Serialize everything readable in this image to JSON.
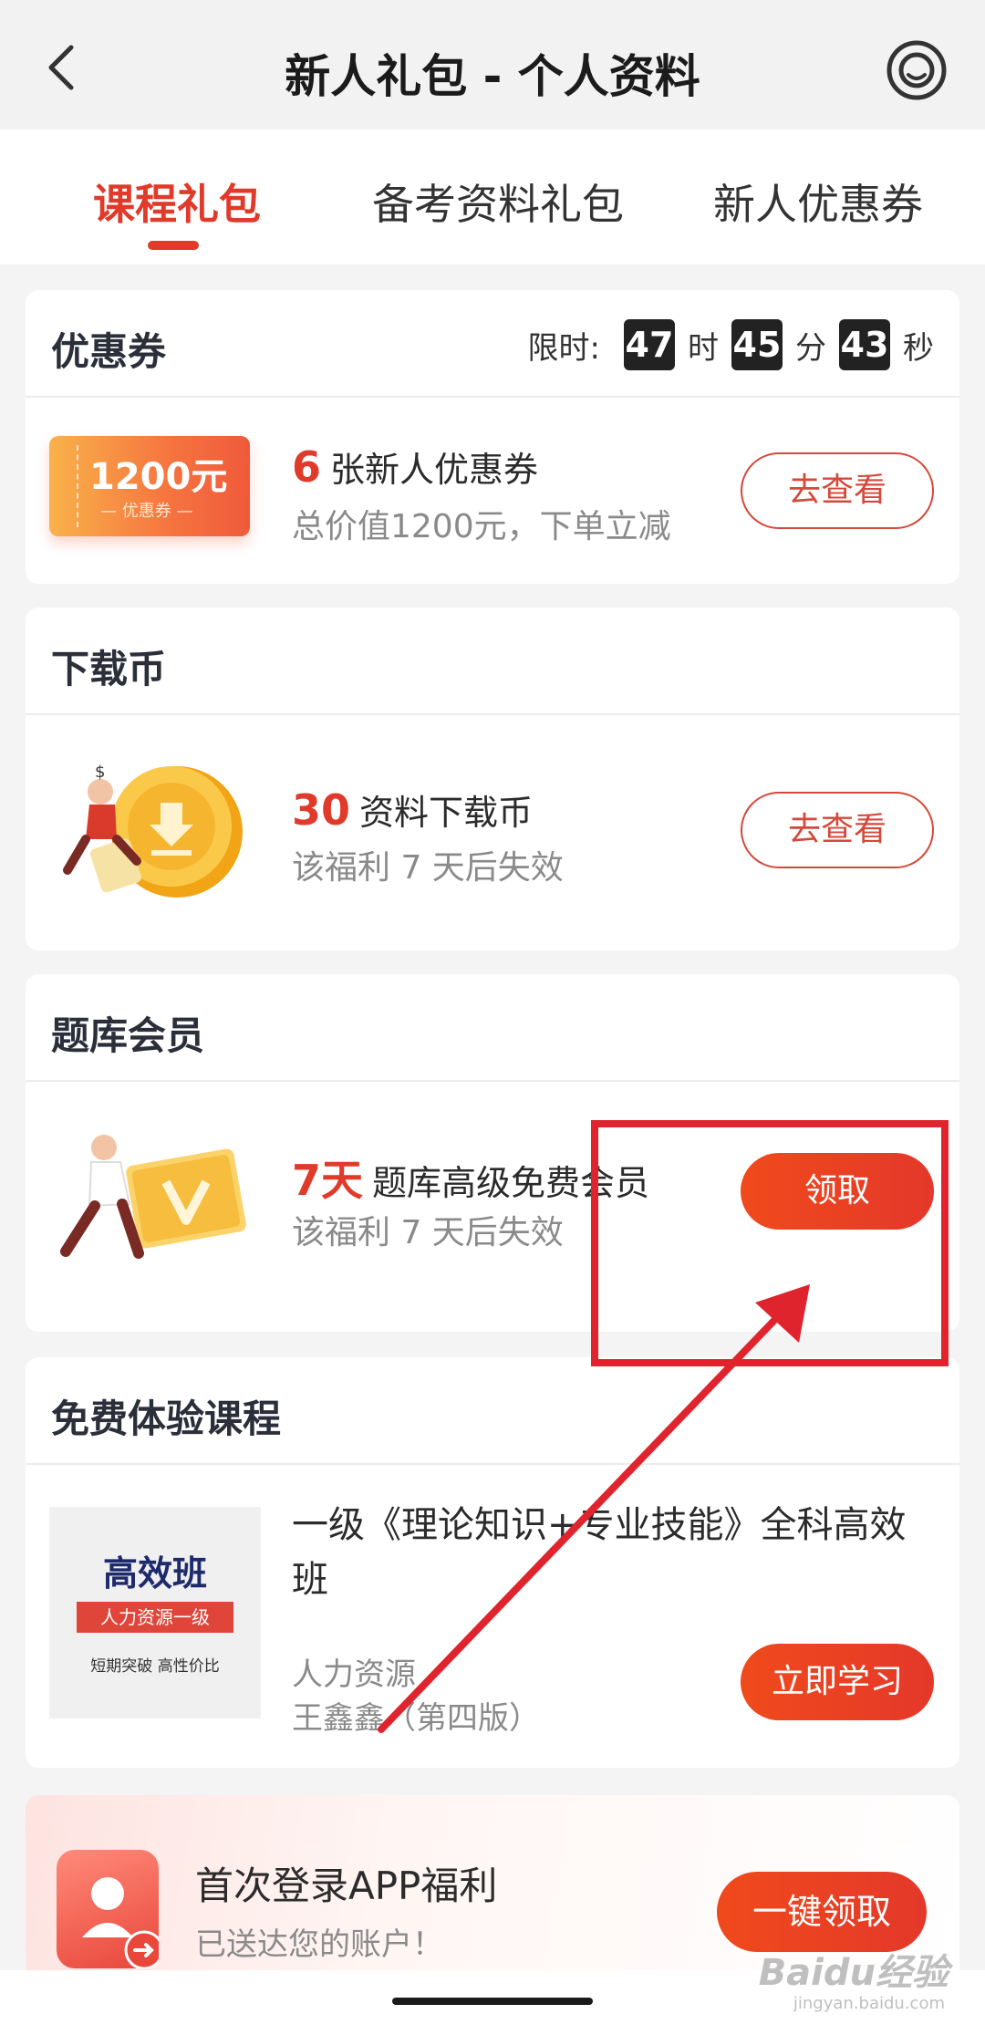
{
  "header": {
    "title": "新人礼包 - 个人资料",
    "back_icon": "chevron-left-icon",
    "service_icon": "customer-service-icon"
  },
  "tabs": [
    {
      "label": "课程礼包",
      "active": true
    },
    {
      "label": "备考资料礼包",
      "active": false
    },
    {
      "label": "新人优惠券",
      "active": false
    }
  ],
  "coupon_card": {
    "title": "优惠券",
    "timer": {
      "label": "限时:",
      "hours": "47",
      "hours_unit": "时",
      "minutes": "45",
      "minutes_unit": "分",
      "seconds": "43",
      "seconds_unit": "秒"
    },
    "image": {
      "amount": "1200元",
      "tag": "— 优惠券 —"
    },
    "count": "6",
    "main_text": "张新人优惠券",
    "sub_text": "总价值1200元，下单立减",
    "button": "去查看"
  },
  "coin_card": {
    "title": "下载币",
    "count": "30",
    "main_text": "资料下载币",
    "sub_text": "该福利 7 天后失效",
    "button": "去查看"
  },
  "member_card": {
    "title": "题库会员",
    "count": "7天",
    "main_text": "题库高级免费会员",
    "sub_text": "该福利 7 天后失效",
    "button": "领取"
  },
  "course_card": {
    "title": "免费体验课程",
    "cover": {
      "title": "高效班",
      "tag": "人力资源一级",
      "sub": "短期突破  高性价比"
    },
    "course_title": "一级《理论知识+专业技能》全科高效班",
    "category": "人力资源",
    "teacher": "王鑫鑫（第四版）",
    "button": "立即学习"
  },
  "promo": {
    "title": "首次登录APP福利",
    "sub": "已送达您的账户！",
    "button": "一键领取"
  },
  "watermark": {
    "brand": "Baidu经验",
    "url": "jingyan.baidu.com"
  },
  "colors": {
    "accent": "#e03a2a",
    "annotation": "#e0242e"
  }
}
